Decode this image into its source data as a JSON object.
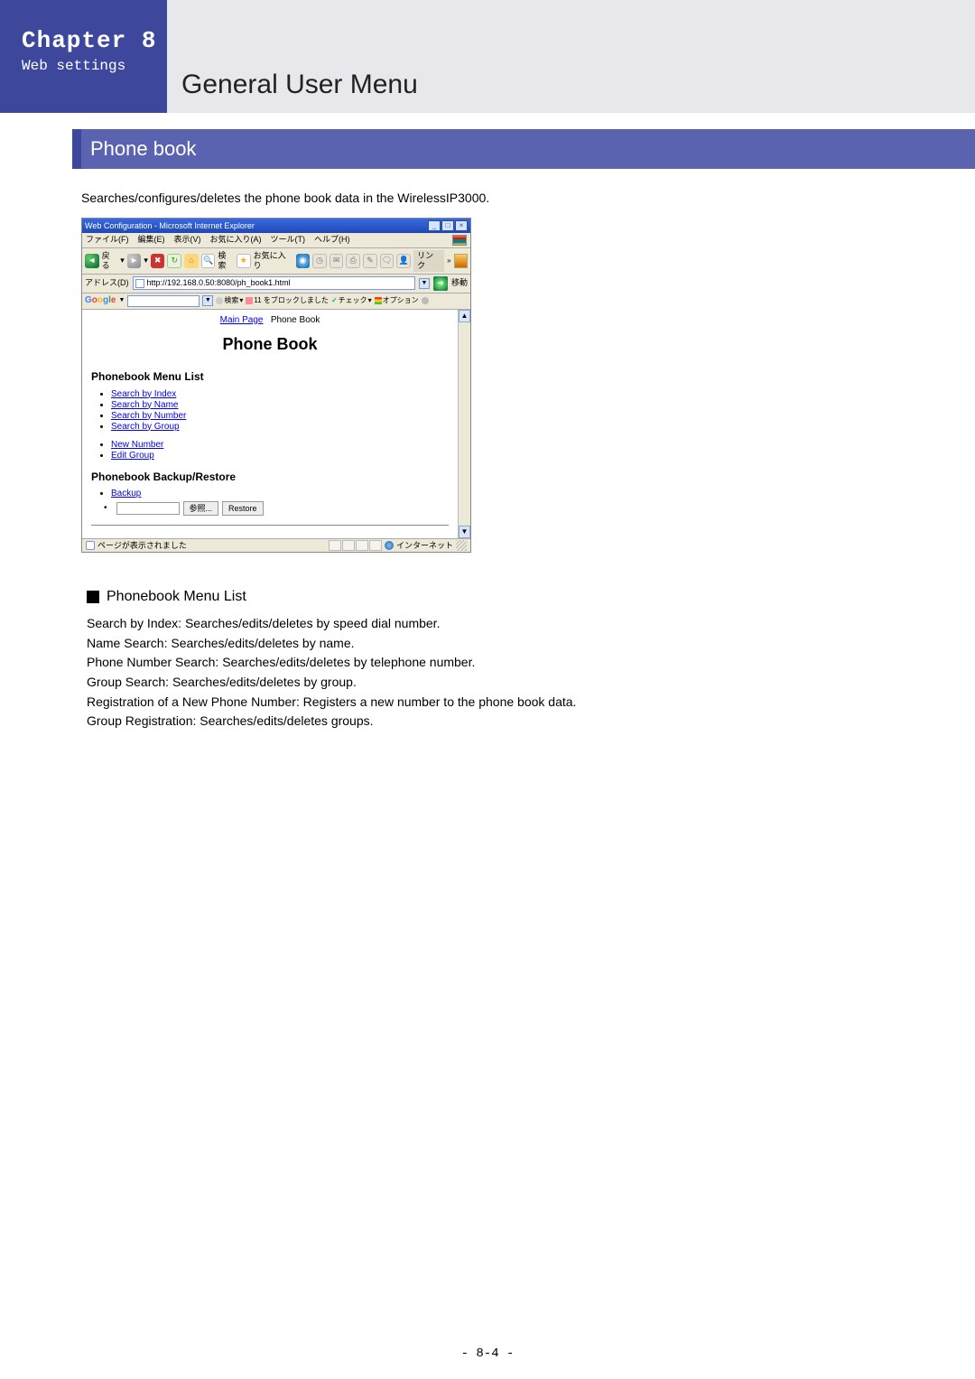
{
  "header": {
    "chapter": "Chapter 8",
    "subtitle": "Web settings",
    "main_title": "General User Menu"
  },
  "section": {
    "title": "Phone book"
  },
  "intro": "Searches/configures/deletes the phone book data in the WirelessIP3000.",
  "browser": {
    "title": "Web Configuration - Microsoft Internet Explorer",
    "menu": [
      "ファイル(F)",
      "編集(E)",
      "表示(V)",
      "お気に入り(A)",
      "ツール(T)",
      "ヘルプ(H)"
    ],
    "toolbar": {
      "back_label": "戻る",
      "search_label": "検索",
      "favorites_label": "お気に入り",
      "links_label": "リンク"
    },
    "address": {
      "label": "アドレス(D)",
      "value": "http://192.168.0.50:8080/ph_book1.html",
      "go_label": "移動"
    },
    "google": {
      "logo_letters": [
        "G",
        "o",
        "o",
        "g",
        "l",
        "e"
      ],
      "search_label": "検索",
      "block_label": "11 をブロックしました",
      "check_label": "チェック",
      "options_label": "オプション"
    },
    "page": {
      "breadcrumb_main": "Main Page",
      "breadcrumb_current": "Phone Book",
      "title": "Phone Book",
      "menu_heading": "Phonebook Menu List",
      "menu_items": [
        "Search by Index",
        "Search by Name",
        "Search by Number",
        "Search by Group"
      ],
      "menu_items2": [
        "New Number",
        "Edit Group"
      ],
      "backup_heading": "Phonebook Backup/Restore",
      "backup_link": "Backup",
      "browse_button": "参照...",
      "restore_button": "Restore"
    },
    "status": {
      "left": "ページが表示されました",
      "right": "インターネット"
    }
  },
  "doc": {
    "heading": "Phonebook Menu List",
    "lines": [
      "Search by Index: Searches/edits/deletes by speed dial number.",
      "Name Search: Searches/edits/deletes by name.",
      "Phone Number Search: Searches/edits/deletes by telephone number.",
      "Group Search: Searches/edits/deletes by group.",
      "Registration of a New Phone Number: Registers a new number to the phone book data.",
      "Group Registration: Searches/edits/deletes groups."
    ]
  },
  "page_number": "- 8-4 -"
}
